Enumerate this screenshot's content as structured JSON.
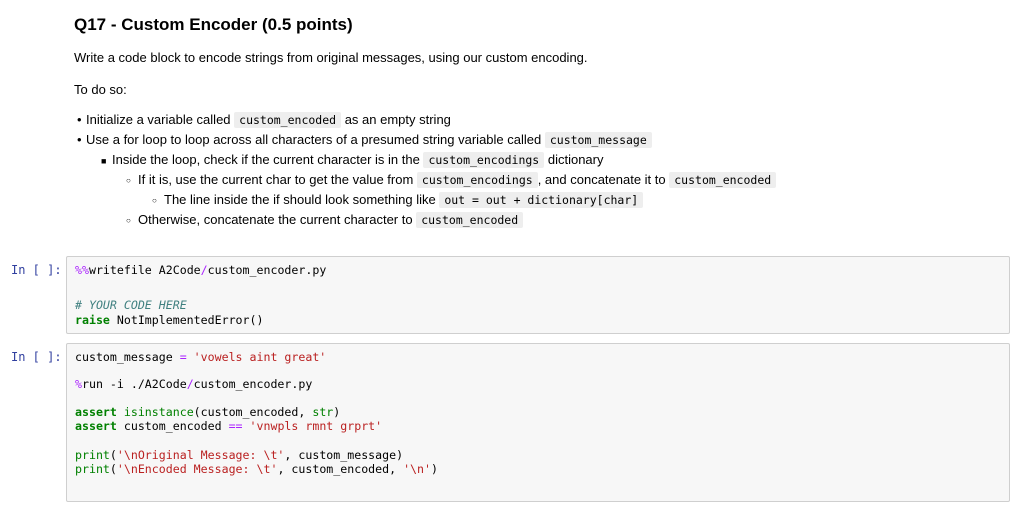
{
  "markdown": {
    "heading": "Q17 - Custom Encoder (0.5 points)",
    "intro": "Write a code block to encode strings from original messages, using our custom encoding.",
    "to_do": "To do so:",
    "items": [
      {
        "pre": "Initialize a variable called ",
        "code": "custom_encoded",
        "post": " as an empty string"
      },
      {
        "pre": "Use a for loop to loop across all characters of a presumed string variable called ",
        "code": "custom_message",
        "post": ""
      },
      {
        "pre": "Inside the loop, check if the current character is in the ",
        "code": "custom_encodings",
        "post": " dictionary"
      },
      {
        "pre": "If it is, use the current char to get the value from ",
        "code": "custom_encodings",
        "mid": ", and concatenate it to ",
        "code2": "custom_encoded"
      },
      {
        "pre": "The line inside the if should look something like ",
        "code": "out = out + dictionary[char]",
        "post": ""
      },
      {
        "pre": "Otherwise, concatenate the current character to ",
        "code": "custom_encoded",
        "post": ""
      }
    ]
  },
  "cells": [
    {
      "prompt": "In [ ]:",
      "lines": {
        "magic": "%%",
        "magic_cmd": "writefile A2Code",
        "slash": "/",
        "path": "custom_encoder.py",
        "comment": "# YOUR CODE HERE",
        "raise_kw": "raise",
        "raise_rest": " NotImplementedError()"
      }
    },
    {
      "prompt": "In [ ]:",
      "lines": {
        "l1_var": "custom_message ",
        "l1_op": "=",
        "l1_str": " 'vowels aint great'",
        "l2_magic": "%",
        "l2_cmd": "run -i ./A2Code",
        "l2_slash": "/",
        "l2_path": "custom_encoder.py",
        "l3_kw": "assert",
        "l3_bi": " isinstance",
        "l3_mid": "(custom_encoded, ",
        "l3_bi2": "str",
        "l3_end": ")",
        "l4_kw": "assert",
        "l4_mid": " custom_encoded ",
        "l4_op": "==",
        "l4_str": " 'vnwpls rmnt grprt'",
        "l5_bi": "print",
        "l5_open": "(",
        "l5_str": "'\\nOriginal Message: \\t'",
        "l5_rest": ", custom_message)",
        "l6_bi": "print",
        "l6_open": "(",
        "l6_str": "'\\nEncoded Message: \\t'",
        "l6_mid": ", custom_encoded, ",
        "l6_str2": "'\\n'",
        "l6_end": ")"
      }
    }
  ]
}
